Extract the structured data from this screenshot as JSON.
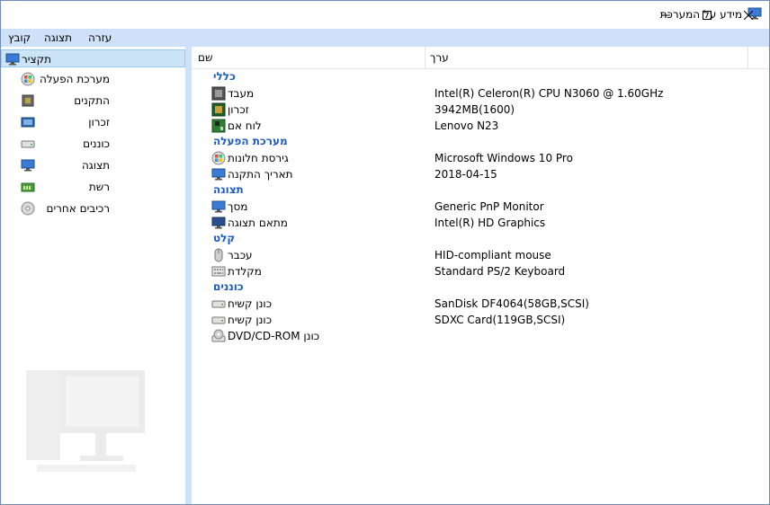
{
  "window": {
    "title": "מידע על המערכת"
  },
  "menu": {
    "file": "קובץ",
    "view": "תצוגה",
    "help": "עזרה"
  },
  "sidebar": {
    "items": [
      {
        "label": "תקציר",
        "icon": "monitor-icon"
      },
      {
        "label": "מערכת הפעלה",
        "icon": "windows-icon"
      },
      {
        "label": "התקנים",
        "icon": "chip-icon"
      },
      {
        "label": "זכרון",
        "icon": "memory-icon"
      },
      {
        "label": "כוננים",
        "icon": "drive-icon"
      },
      {
        "label": "תצוגה",
        "icon": "display-icon"
      },
      {
        "label": "רשת",
        "icon": "network-icon"
      },
      {
        "label": "רכיבים אחרים",
        "icon": "cd-icon"
      }
    ]
  },
  "columns": {
    "name": "שם",
    "value": "ערך"
  },
  "groups": {
    "general": "כללי",
    "os": "מערכת הפעלה",
    "display": "תצוגה",
    "input": "קלט",
    "drives": "כוננים"
  },
  "rows": {
    "cpu": {
      "name": "מעבד",
      "value": "Intel(R) Celeron(R) CPU  N3060  @ 1.60GHz"
    },
    "memory": {
      "name": "זכרון",
      "value": "3942MB(1600)"
    },
    "motherboard": {
      "name": "לוח אם",
      "value": "Lenovo N23"
    },
    "windows_version": {
      "name": "גירסת חלונות",
      "value": "Microsoft Windows 10 Pro"
    },
    "install_date": {
      "name": "תאריך התקנה",
      "value": "2018-04-15"
    },
    "screen": {
      "name": "מסך",
      "value": "Generic PnP Monitor"
    },
    "display_adapter": {
      "name": "מתאם תצוגה",
      "value": "Intel(R) HD Graphics"
    },
    "mouse": {
      "name": "עכבר",
      "value": "HID-compliant mouse"
    },
    "keyboard": {
      "name": "מקלדת",
      "value": "Standard PS/2 Keyboard"
    },
    "hdd1": {
      "name": "כונן קשיח",
      "value": "SanDisk DF4064(58GB,SCSI)"
    },
    "hdd2": {
      "name": "כונן קשיח",
      "value": "SDXC Card(119GB,SCSI)"
    },
    "optical": {
      "name": "כונן DVD/CD-ROM",
      "value": ""
    }
  }
}
